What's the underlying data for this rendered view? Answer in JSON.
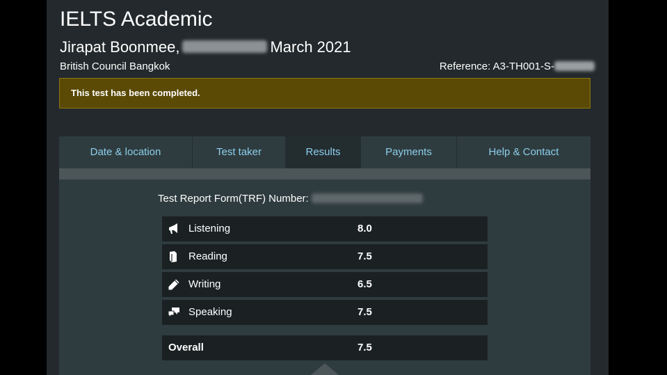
{
  "header": {
    "title": "IELTS Academic",
    "candidate_name": "Jirapat Boonmee,",
    "test_date_visible": "March 2021",
    "test_centre": "British Council Bangkok",
    "reference_label": "Reference: A3-TH001-S-"
  },
  "alert": {
    "message": "This test has been completed."
  },
  "tabs": [
    {
      "label": "Date & location"
    },
    {
      "label": "Test taker"
    },
    {
      "label": "Results"
    },
    {
      "label": "Payments"
    },
    {
      "label": "Help & Contact"
    }
  ],
  "active_tab": "Results",
  "results": {
    "trf_label": "Test Report Form(TRF) Number:",
    "scores": [
      {
        "label": "Listening",
        "value": "8.0",
        "icon": "megaphone-icon"
      },
      {
        "label": "Reading",
        "value": "7.5",
        "icon": "book-icon"
      },
      {
        "label": "Writing",
        "value": "6.5",
        "icon": "pencil-icon"
      },
      {
        "label": "Speaking",
        "value": "7.5",
        "icon": "speech-bubbles-icon"
      }
    ],
    "overall": {
      "label": "Overall",
      "value": "7.5"
    }
  },
  "colors": {
    "background": "#23292c",
    "panel": "#2f3c3f",
    "tab_text": "#8ccfec",
    "alert_bg": "#5b4a06",
    "row_bg": "#1b2123"
  }
}
